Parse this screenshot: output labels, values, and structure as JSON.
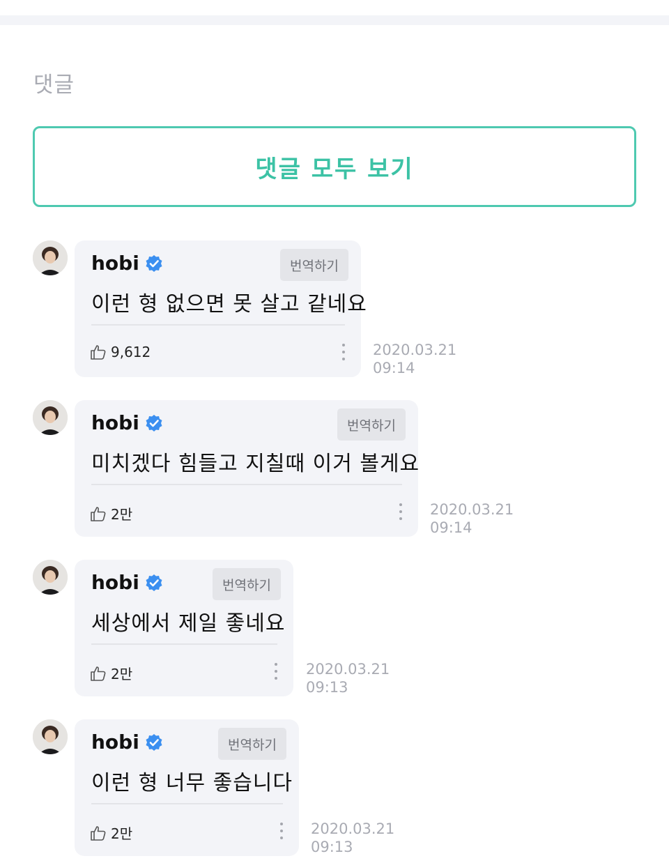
{
  "section": {
    "title": "댓글",
    "view_all_label": "댓글 모두 보기"
  },
  "comments": [
    {
      "author": "hobi",
      "text": "이런 형 없으면 못 살고 같네요",
      "translate_label": "번역하기",
      "likes": "9,612",
      "date": "2020.03.21",
      "time": "09:14"
    },
    {
      "author": "hobi",
      "text": "미치겠다 힘들고 지칠때 이거 볼게요",
      "translate_label": "번역하기",
      "likes": "2만",
      "date": "2020.03.21",
      "time": "09:14"
    },
    {
      "author": "hobi",
      "text": "세상에서 제일 좋네요",
      "translate_label": "번역하기",
      "likes": "2만",
      "date": "2020.03.21",
      "time": "09:13"
    },
    {
      "author": "hobi",
      "text": "이런 형 너무 좋습니다",
      "translate_label": "번역하기",
      "likes": "2만",
      "date": "2020.03.21",
      "time": "09:13"
    }
  ],
  "colors": {
    "accent": "#3cc2a5",
    "verified": "#3b8ff0",
    "bubble": "#f3f4f8"
  }
}
